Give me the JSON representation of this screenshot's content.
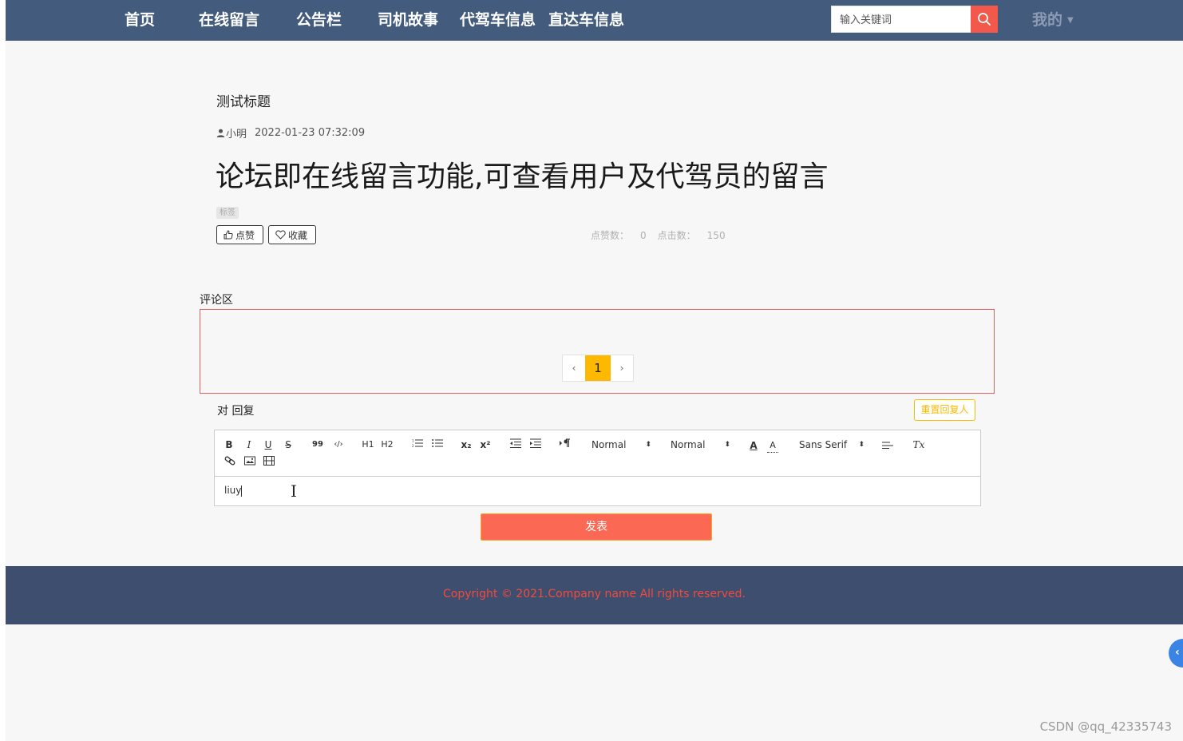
{
  "nav": {
    "items": [
      {
        "label": "首页"
      },
      {
        "label": "在线留言"
      },
      {
        "label": "公告栏"
      },
      {
        "label": "司机故事"
      },
      {
        "label": "代驾车信息"
      },
      {
        "label": "直达车信息"
      }
    ],
    "search_placeholder": "输入关键词",
    "search_icon": "search-icon",
    "user_menu": "我的"
  },
  "article": {
    "subtitle": "测试标题",
    "author": "小明",
    "date": "2022-01-23 07:32:09",
    "headline": "论坛即在线留言功能,可查看用户及代驾员的留言",
    "tag": "标签",
    "like_label": "点赞",
    "favorite_label": "收藏",
    "likes_label": "点赞数：",
    "likes": "0",
    "clicks_label": "点击数：",
    "clicks": "150"
  },
  "comments": {
    "label": "评论区",
    "pager": {
      "prev": "‹",
      "current": "1",
      "next": "›"
    }
  },
  "reply": {
    "label": "对 回复",
    "reset_label": "重置回复人",
    "toolbar": {
      "bold": "B",
      "italic": "I",
      "underline": "U",
      "strike": "S",
      "quote": "99",
      "code": "‹/›",
      "h1": "H1",
      "h2": "H2",
      "sub": "x₂",
      "sup": "x²",
      "size_select": "Normal",
      "header_select": "Normal",
      "color": "A",
      "background": "A",
      "font_select": "Sans Serif",
      "clean": "Tx"
    },
    "content": "liuy",
    "submit_label": "发表"
  },
  "footer": {
    "copyright": "Copyright © 2021.Company name All rights reserved."
  },
  "watermark": "CSDN @qq_42335743",
  "colors": {
    "nav_bg": "#435b7d",
    "footer_bg": "#3d4e6f",
    "accent_red": "#f2594b",
    "accent_yellow": "#ffb800",
    "submit_bg": "#fb6955"
  }
}
